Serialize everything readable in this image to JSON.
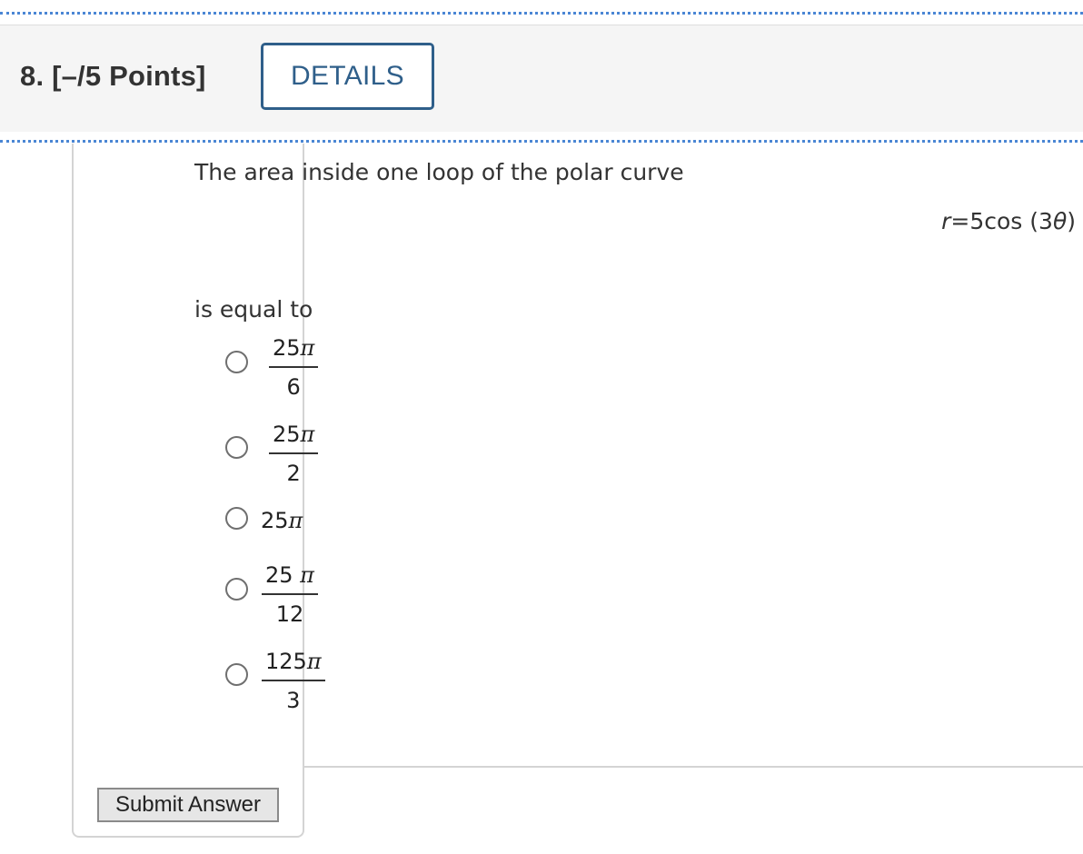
{
  "question": {
    "title": "8.  [–/5 Points]",
    "details_label": "DETAILS",
    "prompt": "The area inside one loop of the polar curve",
    "equation": {
      "lhs": "r",
      "rhs_pre": "=5cos (3",
      "theta": "θ",
      "rhs_post": ")"
    },
    "after_text": "is equal to",
    "options": [
      {
        "num_a": "25",
        "num_b": "π",
        "den": "6"
      },
      {
        "num_a": "25",
        "num_b": "π",
        "den": "2"
      },
      {
        "a": "25",
        "b": "π"
      },
      {
        "num_a": "25 ",
        "num_b": "π",
        "den": "12"
      },
      {
        "num_a": "125",
        "num_b": "π",
        "den": "3"
      }
    ]
  },
  "submit_label": "Submit Answer",
  "colors": {
    "details_accent": "#2f5f8a",
    "dotted_rule": "#4a86d4",
    "header_background": "#f5f5f5"
  }
}
